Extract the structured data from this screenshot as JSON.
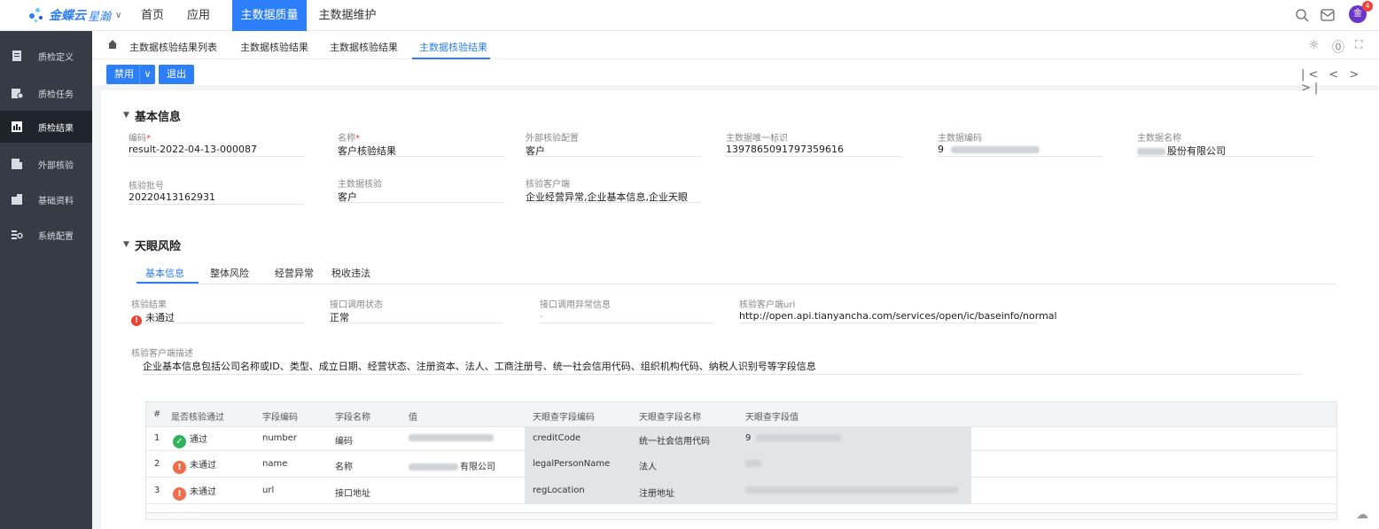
{
  "brand": {
    "name": "金蝶云",
    "sub": "星瀚",
    "colors": {
      "accent": "#2d7ff9",
      "sidebar": "#363b46",
      "danger": "#f04134",
      "success": "#2fb45a"
    }
  },
  "topnav": [
    {
      "label": "首页",
      "active": false
    },
    {
      "label": "应用",
      "active": false
    },
    {
      "label": "主数据质量",
      "active": true
    },
    {
      "label": "主数据维护",
      "active": false
    }
  ],
  "top_icons": [
    "search-icon",
    "message-icon",
    "avatar"
  ],
  "avatar": {
    "initial": "金",
    "badge": "4"
  },
  "sidebar": [
    {
      "label": "质检定义",
      "icon": "document-icon",
      "active": false
    },
    {
      "label": "质检任务",
      "icon": "task-icon",
      "active": false
    },
    {
      "label": "质检结果",
      "icon": "result-icon",
      "active": true
    },
    {
      "label": "外部核验",
      "icon": "external-icon",
      "active": false
    },
    {
      "label": "基础资料",
      "icon": "building-icon",
      "active": false
    },
    {
      "label": "系统配置",
      "icon": "config-icon",
      "active": false
    }
  ],
  "breadcrumbs": [
    "主数据核验结果列表",
    "主数据核验结果",
    "主数据核验结果",
    "主数据核验结果"
  ],
  "toolbar": {
    "disable_label": "禁用",
    "exit_label": "退出",
    "pager": "|< < > >|"
  },
  "basic_section": {
    "title": "基本信息",
    "fields": [
      {
        "label": "编码",
        "required": true,
        "value": "result-2022-04-13-000087"
      },
      {
        "label": "名称",
        "required": true,
        "value": "客户核验结果"
      },
      {
        "label": "外部核验配置",
        "required": false,
        "value": "客户"
      },
      {
        "label": "主数据唯一标识",
        "required": false,
        "value": "1397865091797359616"
      },
      {
        "label": "主数据编码",
        "required": false,
        "value": "9"
      },
      {
        "label": "主数据名称",
        "required": false,
        "value": "股份有限公司"
      },
      {
        "label": "核验批号",
        "required": false,
        "value": "20220413162931"
      },
      {
        "label": "主数据核验",
        "required": false,
        "value": "客户"
      },
      {
        "label": "核验客户端",
        "required": false,
        "value": "企业经营异常,企业基本信息,企业天眼"
      }
    ]
  },
  "risk_section": {
    "title": "天眼风险",
    "tabs": [
      {
        "label": "基本信息",
        "active": true
      },
      {
        "label": "整体风险",
        "active": false
      },
      {
        "label": "经营异常",
        "active": false
      },
      {
        "label": "税收违法",
        "active": false
      }
    ],
    "fields": [
      {
        "label": "核验结果",
        "value": "未通过"
      },
      {
        "label": "接口调用状态",
        "value": "正常"
      },
      {
        "label": "接口调用异常信息",
        "value": "-"
      },
      {
        "label": "核验客户端url",
        "value": "http://open.api.tianyancha.com/services/open/ic/baseinfo/normal"
      }
    ],
    "desc": {
      "label": "核验客户端描述",
      "value": "企业基本信息包括公司名称或ID、类型、成立日期、经营状态、注册资本、法人、工商注册号、统一社会信用代码、组织机构代码、纳税人识别号等字段信息"
    }
  },
  "table": {
    "headers": [
      "#",
      "是否核验通过",
      "字段编码",
      "字段名称",
      "值",
      "天眼查字段编码",
      "天眼查字段名称",
      "天眼查字段值"
    ],
    "rows": [
      {
        "no": "1",
        "pass": "通过",
        "ok": true,
        "code": "number",
        "name": "编码",
        "value": "",
        "ty_code": "creditCode",
        "ty_name": "统一社会信用代码",
        "ty_value": "9"
      },
      {
        "no": "2",
        "pass": "未通过",
        "ok": false,
        "code": "name",
        "name": "名称",
        "value": "有限公司",
        "ty_code": "legalPersonName",
        "ty_name": "法人",
        "ty_value": ""
      },
      {
        "no": "3",
        "pass": "未通过",
        "ok": false,
        "code": "url",
        "name": "接口地址",
        "value": "",
        "ty_code": "regLocation",
        "ty_name": "注册地址",
        "ty_value": ""
      }
    ]
  }
}
